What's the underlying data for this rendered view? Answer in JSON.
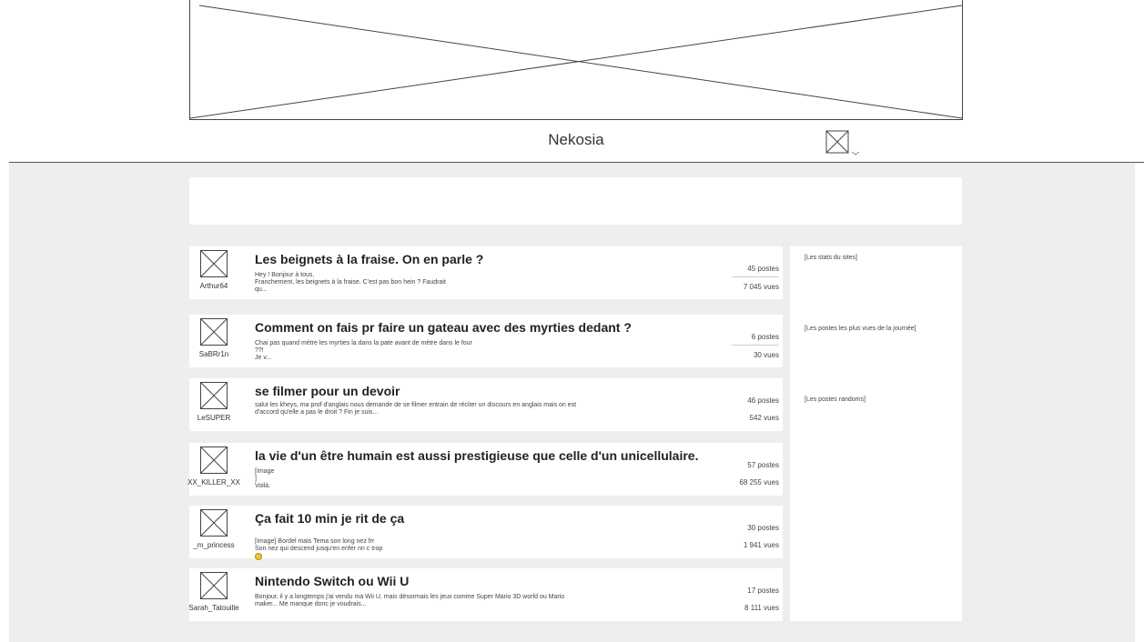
{
  "site": {
    "title": "Nekosia"
  },
  "banner": {
    "icon": "image-placeholder-icon"
  },
  "user_menu": {
    "icon": "image-placeholder-icon",
    "caret": "chevron-down-icon"
  },
  "posts": [
    {
      "author": "Arthur64",
      "title": "Les beignets à la fraise. On en parle ?",
      "excerpt": "Hey ! Bonjour à tous.\nFranchement, les beignets à la fraise. C'est pas bon hein ? Faudrait\nqu...",
      "posts_count": "45 postes",
      "views": "7 045 vues"
    },
    {
      "author": "SaBRr1n",
      "title": "Comment on fais pr faire un gateau avec des myrties dedant ?",
      "excerpt": "Chai pas quand mètre les myrties la dans la pate avant de mètre dans le four\n??!\nJe v...",
      "posts_count": "6 postes",
      "views": "30 vues"
    },
    {
      "author": "LeSUPER",
      "title": "se filmer pour un devoir",
      "excerpt": "salut les kheys, ma prof d'anglais nous demande de se filmer entrain de réciter un discours en anglais mais on est\nd'accord qu'elle a pas le droit ? Fin je suis...",
      "posts_count": "46 postes",
      "views": "542 vues"
    },
    {
      "author": "XX_KILLER_XX",
      "title": "la vie d'un être humain est aussi prestigieuse que celle d'un unicellulaire.",
      "excerpt": "[Image\n]\nVoilà.",
      "posts_count": "57 postes",
      "views": "68 255 vues"
    },
    {
      "author": "_m_princess",
      "title": "Ça fait 10 min je rit de ça",
      "excerpt": "[Image] Bordel mais Tema son long nez frr\nSon nez qui descend jusqu'en enfer nn c trop",
      "posts_count": "30 postes",
      "views": "1 941 vues",
      "emoji": "laughing-emoji"
    },
    {
      "author": "Sarah_Tatouille",
      "title": "Nintendo Switch ou Wii U",
      "excerpt": "Bonjour, il y a longtemps j'ai vendu ma Wii U, mais désormais les jeux comme Super Mario 3D world ou Mario\nmaker... Me manque donc je voudrais...",
      "posts_count": "17 postes",
      "views": "8 111 vues"
    }
  ],
  "sidebar": {
    "stats": "[Les stats du sites]",
    "top_posts": "[Les postes les plus vues de la journée]",
    "random_posts": "[Les postes randoms]"
  }
}
